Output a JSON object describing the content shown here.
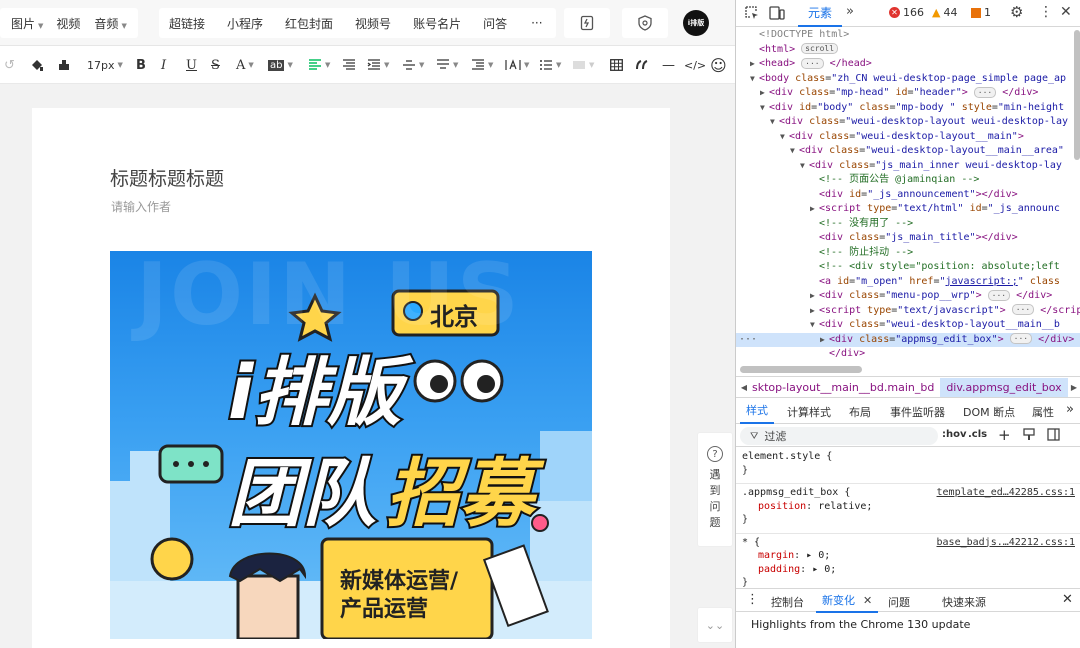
{
  "toolbar1": {
    "media": [
      {
        "label": "图片",
        "caret": true
      },
      {
        "label": "视频",
        "caret": false
      },
      {
        "label": "音频",
        "caret": true
      }
    ],
    "inserts": [
      "超链接",
      "小程序",
      "红包封面",
      "视频号",
      "账号名片",
      "问答"
    ],
    "more": "···",
    "avatar_text": "i排版"
  },
  "toolbar2": {
    "font_size": "17px",
    "bold": "B",
    "italic": "I",
    "underline": "U",
    "strike": "S",
    "font_color": "A",
    "bg_color": "ab",
    "code": "</>",
    "hr": "—",
    "emoji": "☺"
  },
  "document": {
    "title": "标题标题标题",
    "author_placeholder": "请输入作者"
  },
  "poster": {
    "bg_text": "JOIN US",
    "city": "北京",
    "brand": "i排版",
    "team": "团队",
    "recruit": "招募",
    "role1": "新媒体运营/",
    "role2": "产品运营"
  },
  "side": {
    "help": [
      "遇",
      "到",
      "问",
      "题"
    ],
    "help_icon": "?",
    "down": "⌄⌄"
  },
  "devtools": {
    "tab_elements": "元素",
    "errors": "166",
    "warnings": "44",
    "issues": "1",
    "dom_lines": [
      {
        "indent": 0,
        "tri": "",
        "html": "<span class='ttl'>&lt;!DOCTYPE html&gt;</span>"
      },
      {
        "indent": 0,
        "tri": "",
        "html": "<span class='tag'>&lt;html&gt;</span> <span class='dots'>scroll</span>"
      },
      {
        "indent": 0,
        "tri": "▶",
        "html": "<span class='tag'>&lt;head&gt;</span> <span class='dots'>···</span> <span class='tag'>&lt;/head&gt;</span>"
      },
      {
        "indent": 0,
        "tri": "▼",
        "html": "<span class='tag'>&lt;body </span><span class='attr'>class</span>=<span class='val'>\"zh_CN weui-desktop-page_simple page_ap</span>"
      },
      {
        "indent": 1,
        "tri": "▶",
        "html": "<span class='tag'>&lt;div </span><span class='attr'>class</span>=<span class='val'>\"mp-head\"</span> <span class='attr'>id</span>=<span class='val'>\"header\"</span><span class='tag'>&gt;</span> <span class='dots'>···</span> <span class='tag'>&lt;/div&gt;</span>"
      },
      {
        "indent": 1,
        "tri": "▼",
        "html": "<span class='tag'>&lt;div </span><span class='attr'>id</span>=<span class='val'>\"body\"</span> <span class='attr'>class</span>=<span class='val'>\"mp-body \"</span> <span class='attr'>style</span>=<span class='val'>\"min-height</span>"
      },
      {
        "indent": 2,
        "tri": "▼",
        "html": "<span class='tag'>&lt;div </span><span class='attr'>class</span>=<span class='val'>\"weui-desktop-layout weui-desktop-lay</span>"
      },
      {
        "indent": 3,
        "tri": "▼",
        "html": "<span class='tag'>&lt;div </span><span class='attr'>class</span>=<span class='val'>\"weui-desktop-layout__main\"</span><span class='tag'>&gt;</span>"
      },
      {
        "indent": 4,
        "tri": "▼",
        "html": "<span class='tag'>&lt;div </span><span class='attr'>class</span>=<span class='val'>\"weui-desktop-layout__main__area\"</span>"
      },
      {
        "indent": 5,
        "tri": "▼",
        "html": "<span class='tag'>&lt;div </span><span class='attr'>class</span>=<span class='val'>\"js_main_inner weui-desktop-lay</span>"
      },
      {
        "indent": 6,
        "tri": "",
        "html": "<span class='cmt'>&lt;!-- 页面公告 @jaminqian --&gt;</span>"
      },
      {
        "indent": 6,
        "tri": "",
        "html": "<span class='tag'>&lt;div </span><span class='attr'>id</span>=<span class='val'>\"_js_announcement\"</span><span class='tag'>&gt;&lt;/div&gt;</span>"
      },
      {
        "indent": 6,
        "tri": "▶",
        "html": "<span class='tag'>&lt;script </span><span class='attr'>type</span>=<span class='val'>\"text/html\"</span> <span class='attr'>id</span>=<span class='val'>\"_js_announc</span>"
      },
      {
        "indent": 6,
        "tri": "",
        "html": "<span class='cmt'>&lt;!-- 没有用了 --&gt;</span>"
      },
      {
        "indent": 6,
        "tri": "",
        "html": "<span class='tag'>&lt;div </span><span class='attr'>class</span>=<span class='val'>\"js_main_title\"</span><span class='tag'>&gt;&lt;/div&gt;</span>"
      },
      {
        "indent": 6,
        "tri": "",
        "html": "<span class='cmt'>&lt;!-- 防止抖动 --&gt;</span>"
      },
      {
        "indent": 6,
        "tri": "",
        "html": "<span class='cmt'>&lt;!-- &lt;div style=\"position: absolute;left</span>"
      },
      {
        "indent": 6,
        "tri": "",
        "html": "<span class='tag'>&lt;a </span><span class='attr'>id</span>=<span class='val'>\"m_open\"</span> <span class='attr'>href</span>=<span class='val'>\"<u>javascript:;</u>\"</span> <span class='attr'>class</span>"
      },
      {
        "indent": 6,
        "tri": "▶",
        "html": "<span class='tag'>&lt;div </span><span class='attr'>class</span>=<span class='val'>\"menu-pop__wrp\"</span><span class='tag'>&gt;</span> <span class='dots'>···</span> <span class='tag'>&lt;/div&gt;</span>"
      },
      {
        "indent": 6,
        "tri": "▶",
        "html": "<span class='tag'>&lt;script </span><span class='attr'>type</span>=<span class='val'>\"text/javascript\"</span><span class='tag'>&gt;</span> <span class='dots'>···</span> <span class='tag'>&lt;/scrip</span>"
      },
      {
        "indent": 6,
        "tri": "▼",
        "html": "<span class='tag'>&lt;div </span><span class='attr'>class</span>=<span class='val'>\"weui-desktop-layout__main__b</span>"
      },
      {
        "indent": 7,
        "tri": "▶",
        "html": "<span class='tag'>&lt;div </span><span class='attr'>class</span>=<span class='val'>\"appmsg_edit_box\"</span><span class='tag'>&gt;</span> <span class='dots'>···</span> <span class='tag'>&lt;/div&gt;</span>",
        "selected": true
      },
      {
        "indent": 7,
        "tri": "",
        "html": "<span class='tag'>&lt;/div&gt;</span>"
      }
    ],
    "crumbs": [
      "sktop-layout__main__bd.main_bd",
      "div.appmsg_edit_box"
    ],
    "style_tabs": [
      "样式",
      "计算样式",
      "布局",
      "事件监听器",
      "DOM 断点",
      "属性"
    ],
    "filter_placeholder": "过滤",
    "hov": ":hov",
    "cls": ".cls",
    "rules": [
      {
        "selector": "element.style {",
        "source": "",
        "props": [],
        "close": "}"
      },
      {
        "selector": ".appmsg_edit_box {",
        "source": "template_ed…42285.css:1",
        "props": [
          {
            "k": "position",
            "v": "relative;"
          }
        ],
        "close": "}"
      },
      {
        "selector": "* {",
        "source": "base_badjs.…42212.css:1",
        "props": [
          {
            "k": "margin",
            "v": "▸ 0;"
          },
          {
            "k": "padding",
            "v": "▸ 0;"
          }
        ],
        "close": "}"
      }
    ],
    "console_tabs": [
      "控制台",
      "新变化",
      "问题",
      "快速来源"
    ],
    "highlights": "Highlights from the Chrome 130 update"
  }
}
